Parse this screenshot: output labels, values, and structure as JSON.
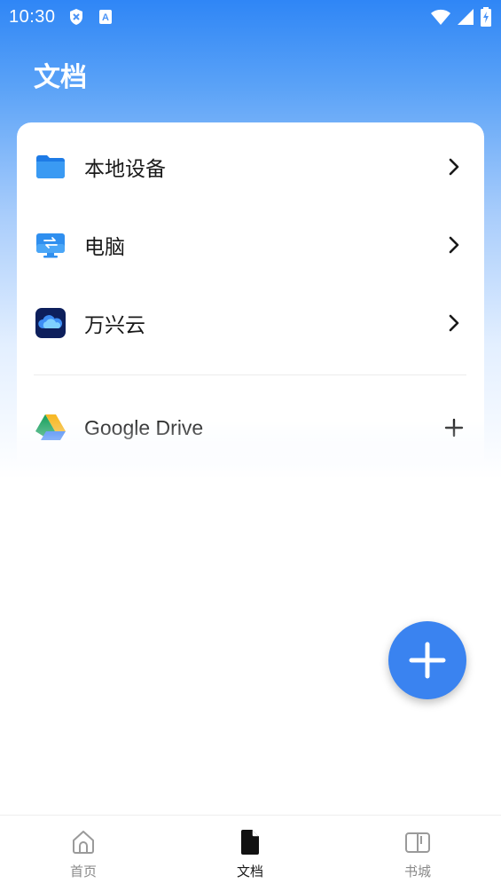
{
  "status_bar": {
    "time": "10:30",
    "icons": [
      "shield-x-icon",
      "keyboard-a-icon",
      "wifi-icon",
      "signal-icon",
      "battery-charging-icon"
    ]
  },
  "header": {
    "title": "文档"
  },
  "locations": [
    {
      "label": "本地设备",
      "icon": "folder-icon",
      "action": "chevron-right-icon"
    },
    {
      "label": "电脑",
      "icon": "computer-icon",
      "action": "chevron-right-icon"
    },
    {
      "label": "万兴云",
      "icon": "cloud-icon",
      "action": "chevron-right-icon"
    }
  ],
  "cloud_services": [
    {
      "label": "Google Drive",
      "icon": "google-drive-icon",
      "action": "plus-icon"
    }
  ],
  "fab": {
    "icon": "plus-icon",
    "color": "#3a83f0"
  },
  "bottom_nav": {
    "items": [
      {
        "label": "首页",
        "icon": "home-icon",
        "active": false
      },
      {
        "label": "文档",
        "icon": "document-icon",
        "active": true
      },
      {
        "label": "书城",
        "icon": "book-icon",
        "active": false
      }
    ]
  },
  "colors": {
    "accent": "#3a83f0",
    "header_gradient_top": "#2f86f6"
  }
}
